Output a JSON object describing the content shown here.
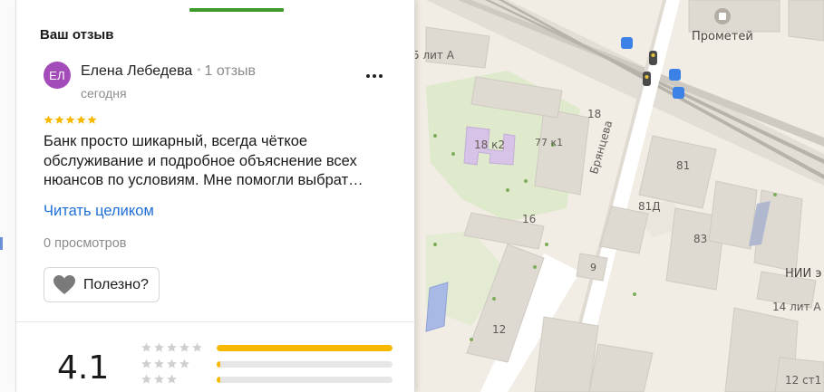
{
  "panel": {
    "section_title": "Ваш отзыв",
    "review": {
      "avatar_initials": "ЕЛ",
      "author_name": "Елена Лебедева",
      "separator": "•",
      "author_reviews_count": "1 отзыв",
      "date": "сегодня",
      "rating": 5,
      "text": "Банк просто шикарный, всегда чёткое обслуживание и подробное объяснение всех нюансов по условиям. Мне помогли выбрат…",
      "read_more": "Читать целиком",
      "views": "0 просмотров",
      "useful_label": "Полезно?",
      "more_icon": "more-dots-icon"
    },
    "summary": {
      "rating_value": "4.1",
      "distribution": [
        {
          "stars": 5,
          "share": 1.0
        },
        {
          "stars": 4,
          "share": 0.02
        },
        {
          "stars": 3,
          "share": 0.02
        }
      ]
    }
  },
  "map": {
    "labels": [
      "Прометей",
      "5 лит А",
      "18 к2",
      "77 к1",
      "18",
      "Брянцева",
      "81",
      "81Д",
      "83",
      "16",
      "9",
      "12",
      "НИИ э",
      "14 лит А",
      "12 ст1"
    ]
  },
  "colors": {
    "accent_green": "#3d9a26",
    "link_blue": "#1f6fd6",
    "star_yellow": "#f7b900",
    "avatar_purple": "#a24bb9"
  }
}
